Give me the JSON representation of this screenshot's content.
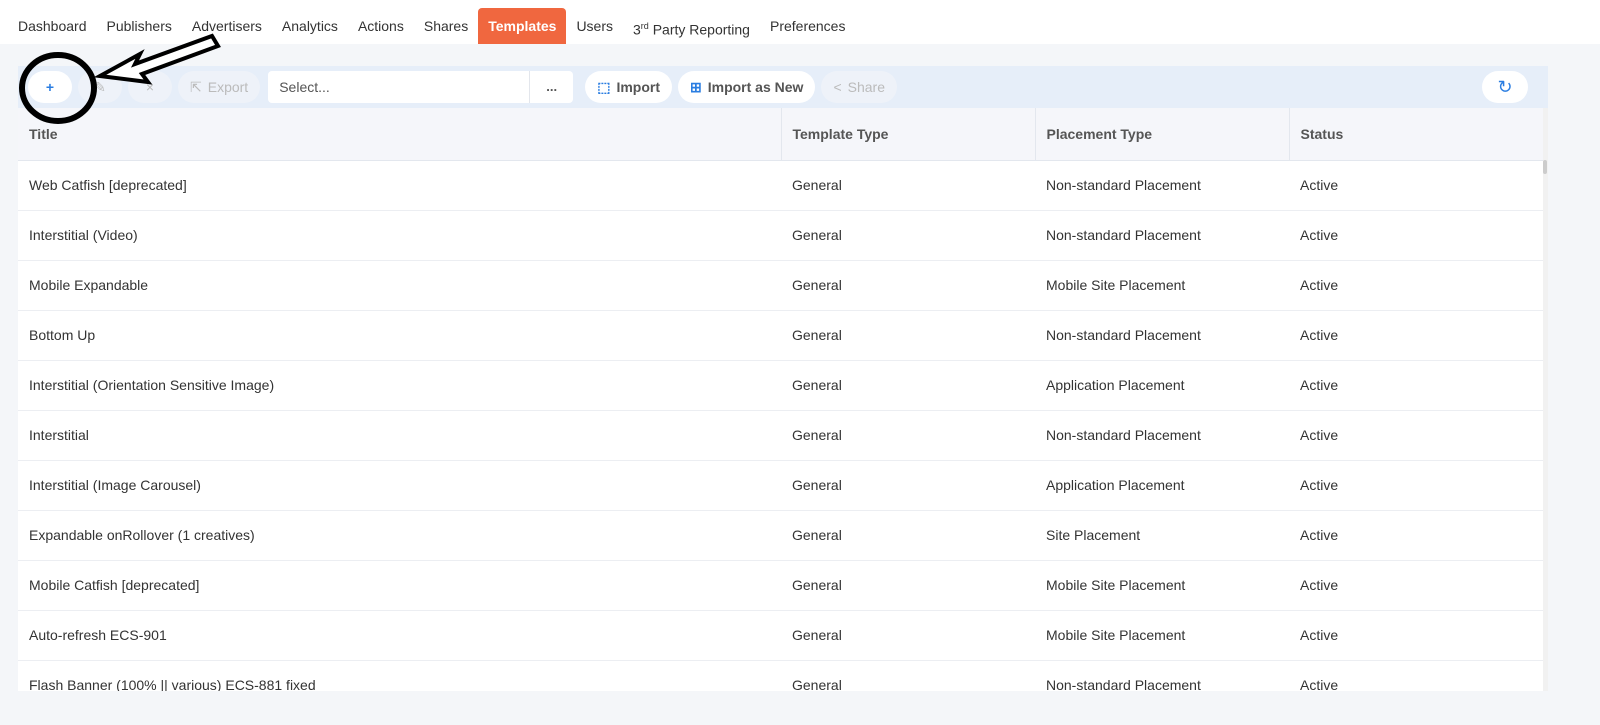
{
  "nav": {
    "tabs": [
      "Dashboard",
      "Publishers",
      "Advertisers",
      "Analytics",
      "Actions",
      "Shares",
      "Templates",
      "Users"
    ],
    "third_party": "3",
    "third_party_sup": "rd",
    "third_party_rest": " Party Reporting",
    "preferences": "Preferences",
    "active": "Templates"
  },
  "toolbar": {
    "add": "+",
    "edit": "✎",
    "delete": "×",
    "export": "Export",
    "select_placeholder": "Select...",
    "more": "...",
    "import": "Import",
    "import_new": "Import as New",
    "share": "Share",
    "refresh": "↻"
  },
  "table": {
    "headers": [
      "Title",
      "Template Type",
      "Placement Type",
      "Status"
    ],
    "rows": [
      [
        "Web Catfish [deprecated]",
        "General",
        "Non-standard Placement",
        "Active"
      ],
      [
        "Interstitial (Video)",
        "General",
        "Non-standard Placement",
        "Active"
      ],
      [
        "Mobile Expandable",
        "General",
        "Mobile Site Placement",
        "Active"
      ],
      [
        "Bottom Up",
        "General",
        "Non-standard Placement",
        "Active"
      ],
      [
        "Interstitial (Orientation Sensitive Image)",
        "General",
        "Application Placement",
        "Active"
      ],
      [
        "Interstitial",
        "General",
        "Non-standard Placement",
        "Active"
      ],
      [
        "Interstitial (Image Carousel)",
        "General",
        "Application Placement",
        "Active"
      ],
      [
        "Expandable onRollover (1 creatives)",
        "General",
        "Site Placement",
        "Active"
      ],
      [
        "Mobile Catfish [deprecated]",
        "General",
        "Mobile Site Placement",
        "Active"
      ],
      [
        "Auto-refresh ECS-901",
        "General",
        "Mobile Site Placement",
        "Active"
      ],
      [
        "Flash Banner (100% || various) ECS-881 fixed",
        "General",
        "Non-standard Placement",
        "Active"
      ]
    ]
  },
  "colors": {
    "accent": "#f0673f",
    "toolbar": "#e6eef9",
    "link": "#2a7de1"
  }
}
